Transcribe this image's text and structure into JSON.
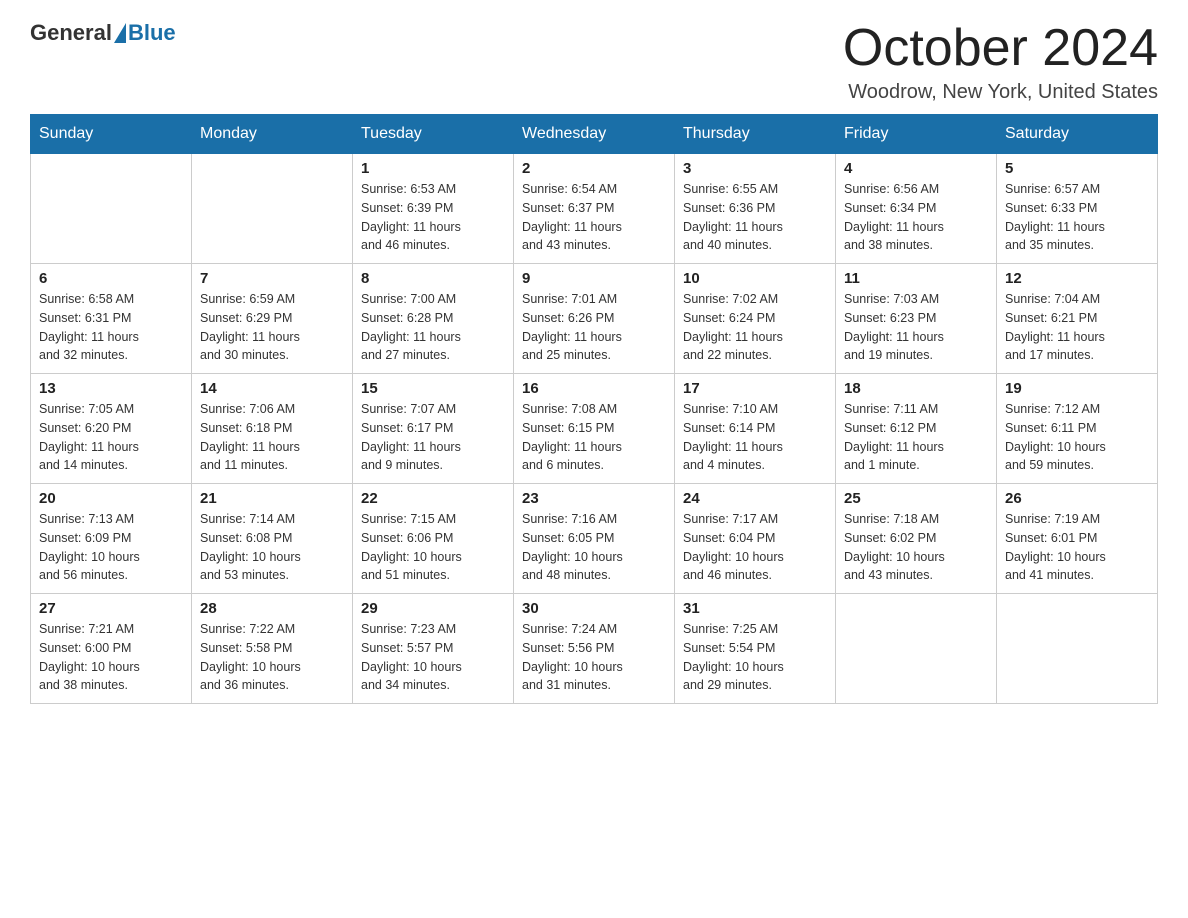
{
  "logo": {
    "general": "General",
    "blue": "Blue"
  },
  "title": "October 2024",
  "location": "Woodrow, New York, United States",
  "weekdays": [
    "Sunday",
    "Monday",
    "Tuesday",
    "Wednesday",
    "Thursday",
    "Friday",
    "Saturday"
  ],
  "weeks": [
    [
      {
        "day": "",
        "info": ""
      },
      {
        "day": "",
        "info": ""
      },
      {
        "day": "1",
        "info": "Sunrise: 6:53 AM\nSunset: 6:39 PM\nDaylight: 11 hours\nand 46 minutes."
      },
      {
        "day": "2",
        "info": "Sunrise: 6:54 AM\nSunset: 6:37 PM\nDaylight: 11 hours\nand 43 minutes."
      },
      {
        "day": "3",
        "info": "Sunrise: 6:55 AM\nSunset: 6:36 PM\nDaylight: 11 hours\nand 40 minutes."
      },
      {
        "day": "4",
        "info": "Sunrise: 6:56 AM\nSunset: 6:34 PM\nDaylight: 11 hours\nand 38 minutes."
      },
      {
        "day": "5",
        "info": "Sunrise: 6:57 AM\nSunset: 6:33 PM\nDaylight: 11 hours\nand 35 minutes."
      }
    ],
    [
      {
        "day": "6",
        "info": "Sunrise: 6:58 AM\nSunset: 6:31 PM\nDaylight: 11 hours\nand 32 minutes."
      },
      {
        "day": "7",
        "info": "Sunrise: 6:59 AM\nSunset: 6:29 PM\nDaylight: 11 hours\nand 30 minutes."
      },
      {
        "day": "8",
        "info": "Sunrise: 7:00 AM\nSunset: 6:28 PM\nDaylight: 11 hours\nand 27 minutes."
      },
      {
        "day": "9",
        "info": "Sunrise: 7:01 AM\nSunset: 6:26 PM\nDaylight: 11 hours\nand 25 minutes."
      },
      {
        "day": "10",
        "info": "Sunrise: 7:02 AM\nSunset: 6:24 PM\nDaylight: 11 hours\nand 22 minutes."
      },
      {
        "day": "11",
        "info": "Sunrise: 7:03 AM\nSunset: 6:23 PM\nDaylight: 11 hours\nand 19 minutes."
      },
      {
        "day": "12",
        "info": "Sunrise: 7:04 AM\nSunset: 6:21 PM\nDaylight: 11 hours\nand 17 minutes."
      }
    ],
    [
      {
        "day": "13",
        "info": "Sunrise: 7:05 AM\nSunset: 6:20 PM\nDaylight: 11 hours\nand 14 minutes."
      },
      {
        "day": "14",
        "info": "Sunrise: 7:06 AM\nSunset: 6:18 PM\nDaylight: 11 hours\nand 11 minutes."
      },
      {
        "day": "15",
        "info": "Sunrise: 7:07 AM\nSunset: 6:17 PM\nDaylight: 11 hours\nand 9 minutes."
      },
      {
        "day": "16",
        "info": "Sunrise: 7:08 AM\nSunset: 6:15 PM\nDaylight: 11 hours\nand 6 minutes."
      },
      {
        "day": "17",
        "info": "Sunrise: 7:10 AM\nSunset: 6:14 PM\nDaylight: 11 hours\nand 4 minutes."
      },
      {
        "day": "18",
        "info": "Sunrise: 7:11 AM\nSunset: 6:12 PM\nDaylight: 11 hours\nand 1 minute."
      },
      {
        "day": "19",
        "info": "Sunrise: 7:12 AM\nSunset: 6:11 PM\nDaylight: 10 hours\nand 59 minutes."
      }
    ],
    [
      {
        "day": "20",
        "info": "Sunrise: 7:13 AM\nSunset: 6:09 PM\nDaylight: 10 hours\nand 56 minutes."
      },
      {
        "day": "21",
        "info": "Sunrise: 7:14 AM\nSunset: 6:08 PM\nDaylight: 10 hours\nand 53 minutes."
      },
      {
        "day": "22",
        "info": "Sunrise: 7:15 AM\nSunset: 6:06 PM\nDaylight: 10 hours\nand 51 minutes."
      },
      {
        "day": "23",
        "info": "Sunrise: 7:16 AM\nSunset: 6:05 PM\nDaylight: 10 hours\nand 48 minutes."
      },
      {
        "day": "24",
        "info": "Sunrise: 7:17 AM\nSunset: 6:04 PM\nDaylight: 10 hours\nand 46 minutes."
      },
      {
        "day": "25",
        "info": "Sunrise: 7:18 AM\nSunset: 6:02 PM\nDaylight: 10 hours\nand 43 minutes."
      },
      {
        "day": "26",
        "info": "Sunrise: 7:19 AM\nSunset: 6:01 PM\nDaylight: 10 hours\nand 41 minutes."
      }
    ],
    [
      {
        "day": "27",
        "info": "Sunrise: 7:21 AM\nSunset: 6:00 PM\nDaylight: 10 hours\nand 38 minutes."
      },
      {
        "day": "28",
        "info": "Sunrise: 7:22 AM\nSunset: 5:58 PM\nDaylight: 10 hours\nand 36 minutes."
      },
      {
        "day": "29",
        "info": "Sunrise: 7:23 AM\nSunset: 5:57 PM\nDaylight: 10 hours\nand 34 minutes."
      },
      {
        "day": "30",
        "info": "Sunrise: 7:24 AM\nSunset: 5:56 PM\nDaylight: 10 hours\nand 31 minutes."
      },
      {
        "day": "31",
        "info": "Sunrise: 7:25 AM\nSunset: 5:54 PM\nDaylight: 10 hours\nand 29 minutes."
      },
      {
        "day": "",
        "info": ""
      },
      {
        "day": "",
        "info": ""
      }
    ]
  ]
}
